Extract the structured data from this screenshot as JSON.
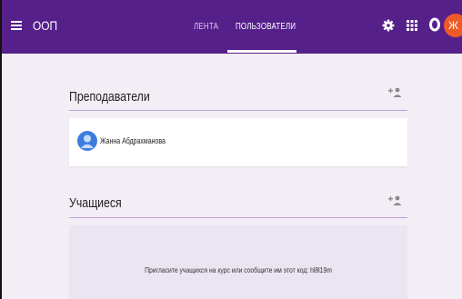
{
  "appbar": {
    "course_title": "ООП",
    "tabs": [
      {
        "label": "ЛЕНТА",
        "active": false
      },
      {
        "label": "ПОЛЬЗОВАТЕЛИ",
        "active": true
      }
    ],
    "icons": [
      "menu-icon",
      "gear-icon",
      "apps-grid-icon",
      "ring-icon"
    ],
    "avatar_letter": "Ж",
    "colors": {
      "bar": "#56208a",
      "avatar": "#ee5a27"
    }
  },
  "teachers": {
    "heading": "Преподаватели",
    "members": [
      {
        "name": "Жанна Абдрахманова"
      }
    ]
  },
  "students": {
    "heading": "Учащиеся",
    "invite_text": "Пригласите учащихся на курс или сообщите им этот код: hl8l19m"
  },
  "colors": {
    "background": "#f3eef6",
    "divider": "#bda2da"
  }
}
